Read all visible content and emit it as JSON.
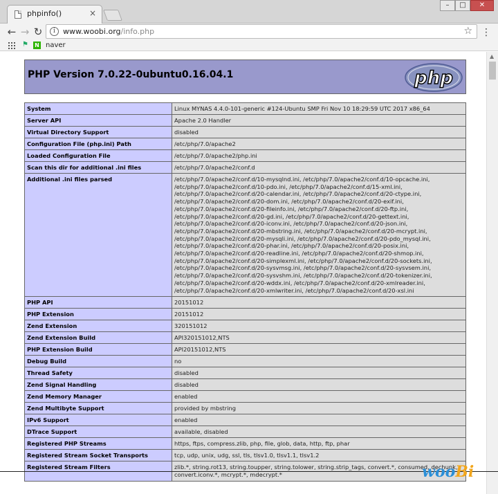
{
  "browser": {
    "tab_title": "phpinfo()",
    "tab_close": "×",
    "window_buttons": {
      "minimize": "–",
      "maximize": "□",
      "close": "✕"
    },
    "nav": {
      "back": "←",
      "forward": "→",
      "reload": "↻"
    },
    "url_host": "www.woobi.org",
    "url_path": "/info.php",
    "bookmarks": [
      {
        "label": "naver"
      }
    ]
  },
  "page": {
    "title": "PHP Version 7.0.22-0ubuntu0.16.04.1",
    "logo_text": "php",
    "rows": [
      {
        "key": "System",
        "value": "Linux MYNAS 4.4.0-101-generic #124-Ubuntu SMP Fri Nov 10 18:29:59 UTC 2017 x86_64"
      },
      {
        "key": "Server API",
        "value": "Apache 2.0 Handler"
      },
      {
        "key": "Virtual Directory Support",
        "value": "disabled"
      },
      {
        "key": "Configuration File (php.ini) Path",
        "value": "/etc/php/7.0/apache2"
      },
      {
        "key": "Loaded Configuration File",
        "value": "/etc/php/7.0/apache2/php.ini"
      },
      {
        "key": "Scan this dir for additional .ini files",
        "value": "/etc/php/7.0/apache2/conf.d"
      },
      {
        "key": "Additional .ini files parsed",
        "lines": [
          "/etc/php/7.0/apache2/conf.d/10-mysqlnd.ini, /etc/php/7.0/apache2/conf.d/10-opcache.ini,",
          "/etc/php/7.0/apache2/conf.d/10-pdo.ini, /etc/php/7.0/apache2/conf.d/15-xml.ini,",
          "/etc/php/7.0/apache2/conf.d/20-calendar.ini, /etc/php/7.0/apache2/conf.d/20-ctype.ini,",
          "/etc/php/7.0/apache2/conf.d/20-dom.ini, /etc/php/7.0/apache2/conf.d/20-exif.ini,",
          "/etc/php/7.0/apache2/conf.d/20-fileinfo.ini, /etc/php/7.0/apache2/conf.d/20-ftp.ini,",
          "/etc/php/7.0/apache2/conf.d/20-gd.ini, /etc/php/7.0/apache2/conf.d/20-gettext.ini,",
          "/etc/php/7.0/apache2/conf.d/20-iconv.ini, /etc/php/7.0/apache2/conf.d/20-json.ini,",
          "/etc/php/7.0/apache2/conf.d/20-mbstring.ini, /etc/php/7.0/apache2/conf.d/20-mcrypt.ini,",
          "/etc/php/7.0/apache2/conf.d/20-mysqli.ini, /etc/php/7.0/apache2/conf.d/20-pdo_mysql.ini,",
          "/etc/php/7.0/apache2/conf.d/20-phar.ini, /etc/php/7.0/apache2/conf.d/20-posix.ini,",
          "/etc/php/7.0/apache2/conf.d/20-readline.ini, /etc/php/7.0/apache2/conf.d/20-shmop.ini,",
          "/etc/php/7.0/apache2/conf.d/20-simplexml.ini, /etc/php/7.0/apache2/conf.d/20-sockets.ini,",
          "/etc/php/7.0/apache2/conf.d/20-sysvmsg.ini, /etc/php/7.0/apache2/conf.d/20-sysvsem.ini,",
          "/etc/php/7.0/apache2/conf.d/20-sysvshm.ini, /etc/php/7.0/apache2/conf.d/20-tokenizer.ini,",
          "/etc/php/7.0/apache2/conf.d/20-wddx.ini, /etc/php/7.0/apache2/conf.d/20-xmlreader.ini,",
          "/etc/php/7.0/apache2/conf.d/20-xmlwriter.ini, /etc/php/7.0/apache2/conf.d/20-xsl.ini"
        ]
      },
      {
        "key": "PHP API",
        "value": "20151012"
      },
      {
        "key": "PHP Extension",
        "value": "20151012"
      },
      {
        "key": "Zend Extension",
        "value": "320151012"
      },
      {
        "key": "Zend Extension Build",
        "value": "API320151012,NTS"
      },
      {
        "key": "PHP Extension Build",
        "value": "API20151012,NTS"
      },
      {
        "key": "Debug Build",
        "value": "no"
      },
      {
        "key": "Thread Safety",
        "value": "disabled"
      },
      {
        "key": "Zend Signal Handling",
        "value": "disabled"
      },
      {
        "key": "Zend Memory Manager",
        "value": "enabled"
      },
      {
        "key": "Zend Multibyte Support",
        "value": "provided by mbstring"
      },
      {
        "key": "IPv6 Support",
        "value": "enabled"
      },
      {
        "key": "DTrace Support",
        "value": "available, disabled"
      },
      {
        "key": "Registered PHP Streams",
        "value": "https, ftps, compress.zlib, php, file, glob, data, http, ftp, phar"
      },
      {
        "key": "Registered Stream Socket Transports",
        "value": "tcp, udp, unix, udg, ssl, tls, tlsv1.0, tlsv1.1, tlsv1.2"
      },
      {
        "key": "Registered Stream Filters",
        "lines": [
          "zlib.*, string.rot13, string.toupper, string.tolower, string.strip_tags, convert.*, consumed, dechunk,",
          "convert.iconv.*, mcrypt.*, mdecrypt.*"
        ]
      }
    ]
  },
  "watermark": {
    "part1": "woo",
    "part2": "Bi"
  },
  "colors": {
    "header_bg": "#9999cc",
    "key_bg": "#ccccff",
    "value_bg": "#dddddd",
    "border": "#666666"
  }
}
